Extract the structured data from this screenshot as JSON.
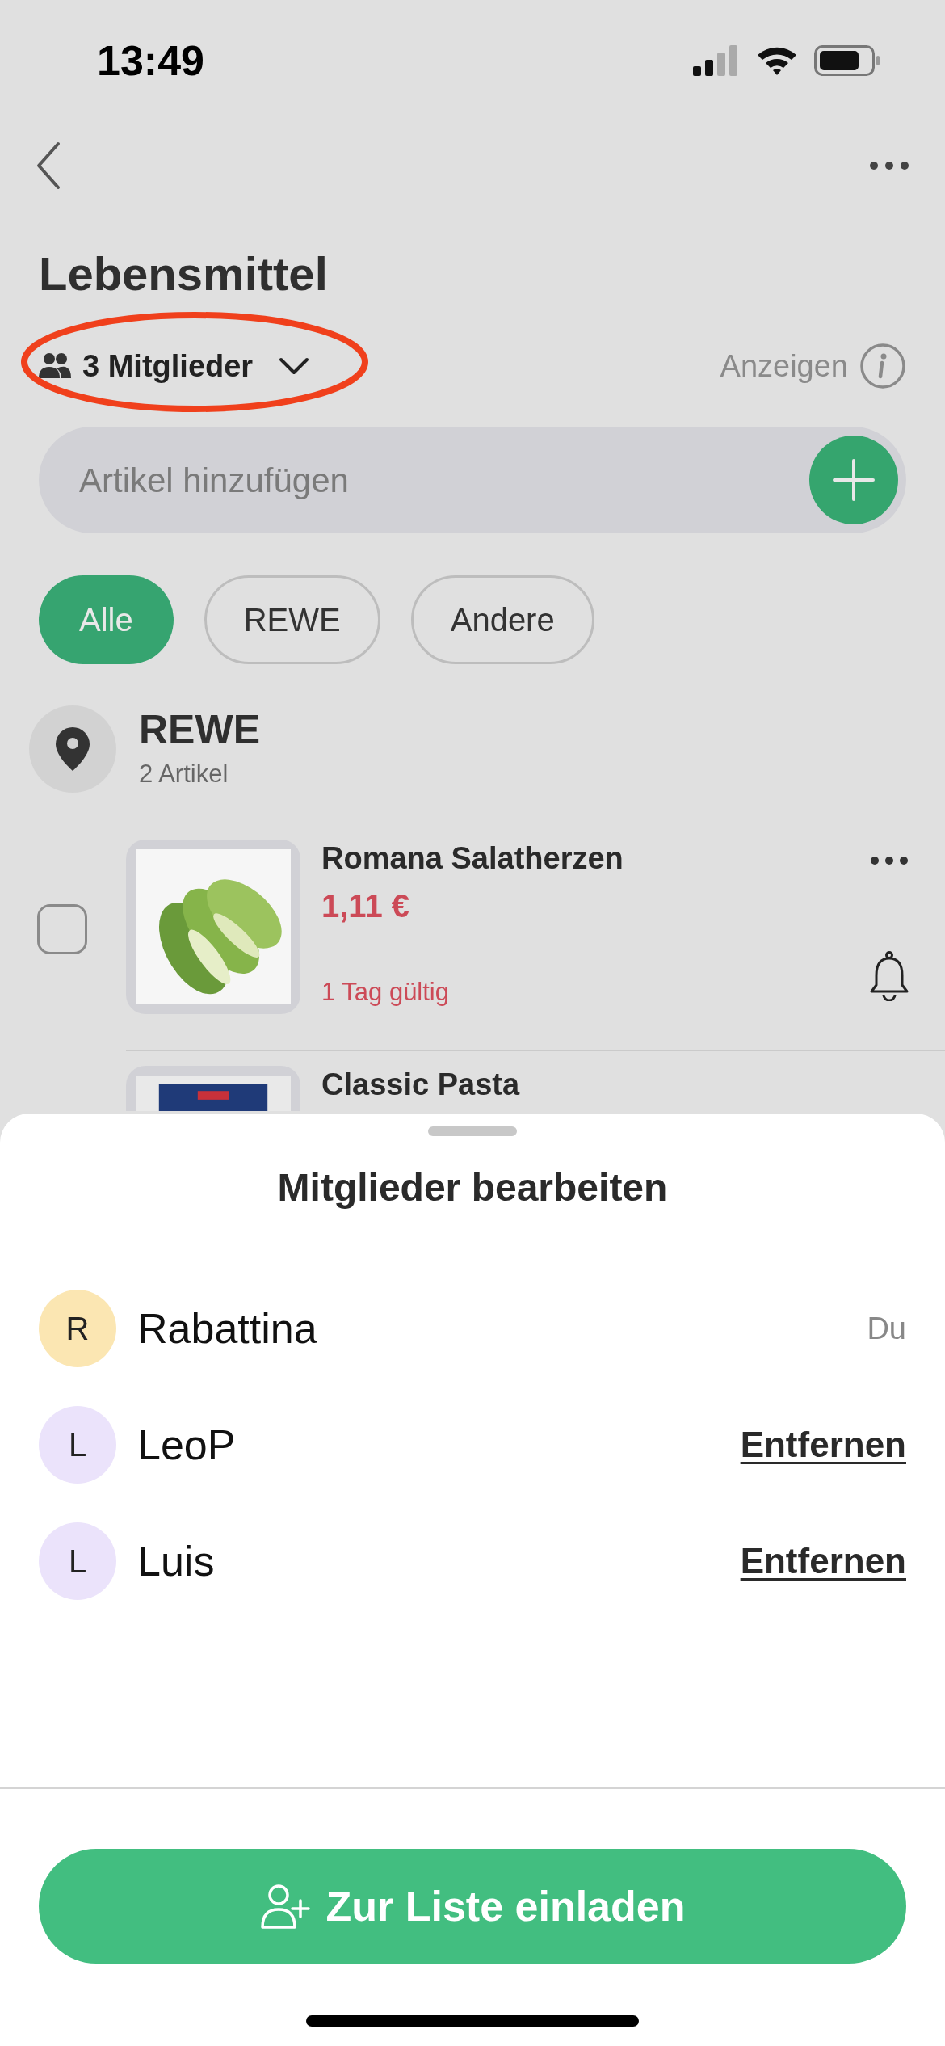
{
  "status_bar": {
    "time": "13:49"
  },
  "header": {
    "title": "Lebensmittel",
    "members": {
      "label": "3 Mitglieder",
      "highlighted": true
    },
    "show_link": "Anzeigen"
  },
  "add_field": {
    "placeholder": "Artikel hinzufügen"
  },
  "filters": [
    {
      "label": "Alle",
      "selected": true
    },
    {
      "label": "REWE",
      "selected": false
    },
    {
      "label": "Andere",
      "selected": false
    }
  ],
  "section": {
    "title": "REWE",
    "count": "2 Artikel"
  },
  "items": [
    {
      "name": "Romana Salatherzen",
      "price": "1,11 €",
      "validity": "1 Tag gültig",
      "checked": false
    },
    {
      "name": "Classic Pasta"
    }
  ],
  "sheet": {
    "title": "Mitglieder bearbeiten",
    "members": [
      {
        "initial": "R",
        "name": "Rabattina",
        "color": "#fbe6b2",
        "kind": "self",
        "action": "Du"
      },
      {
        "initial": "L",
        "name": "LeoP",
        "color": "#ebe3fb",
        "kind": "other",
        "action": "Entfernen"
      },
      {
        "initial": "L",
        "name": "Luis",
        "color": "#ebe3fb",
        "kind": "other",
        "action": "Entfernen"
      }
    ],
    "invite_button": "Zur Liste einladen"
  }
}
